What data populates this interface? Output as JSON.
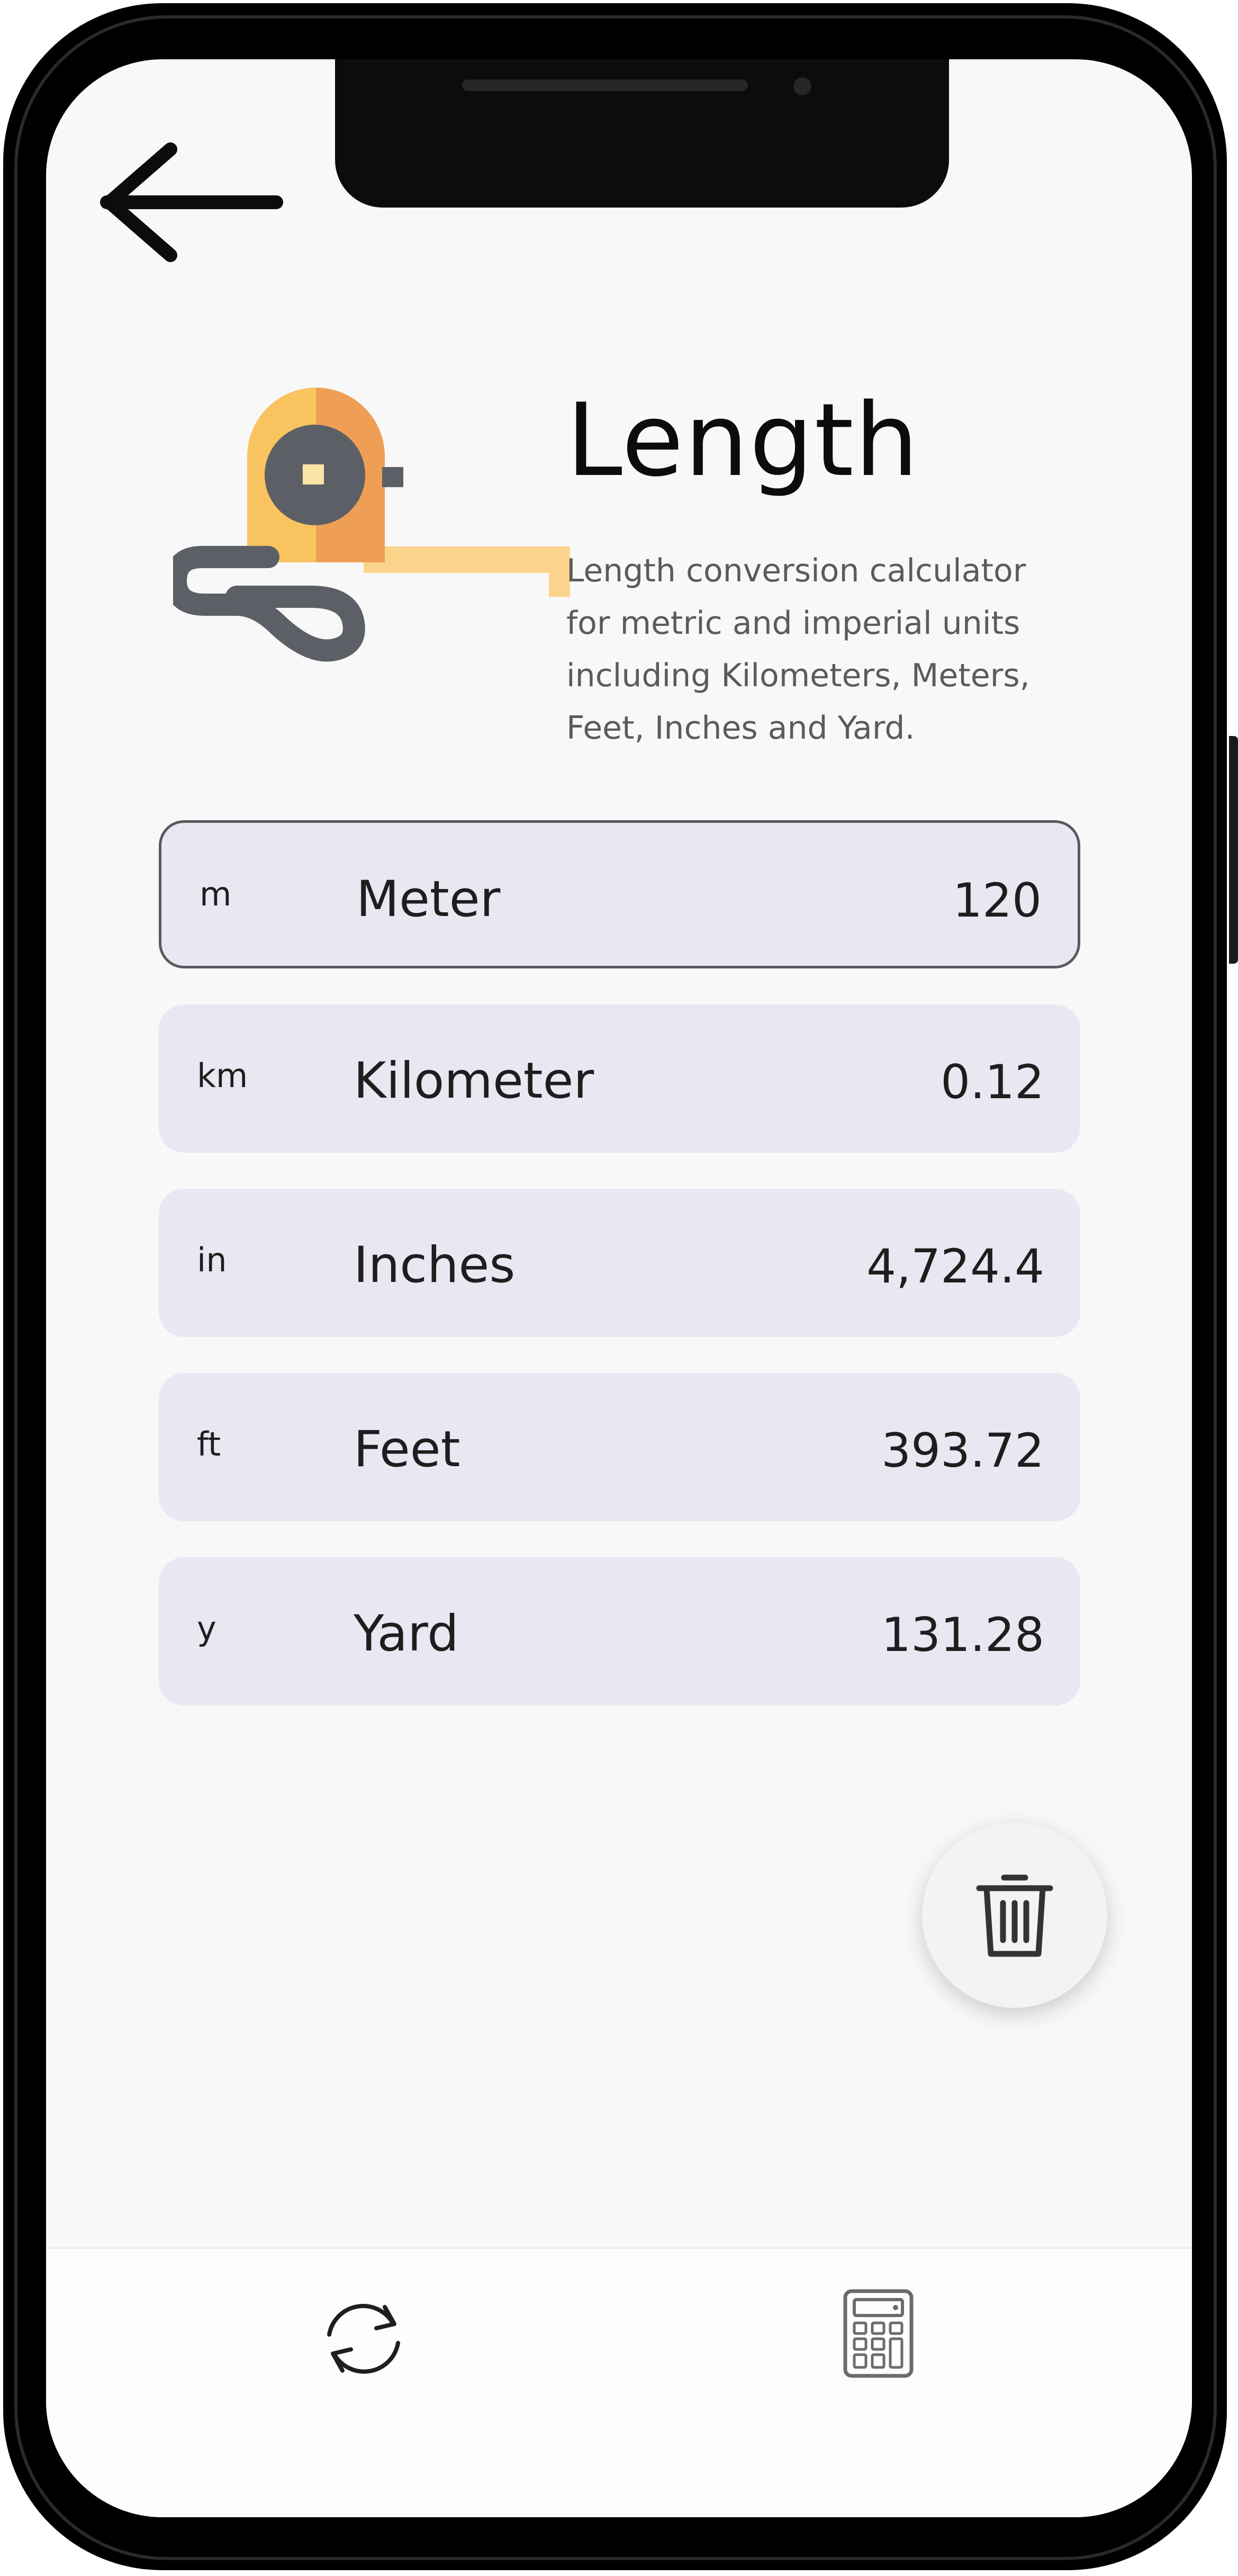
{
  "header": {
    "back_icon": "arrow-left-icon",
    "title": "Length",
    "description": "Length conversion calculator for metric and imperial units including Kilometers, Meters, Feet, Inches and Yard."
  },
  "hero": {
    "icon": "tape-measure-icon",
    "colors": {
      "body_light": "#f9c45f",
      "body_dark": "#ef9f55",
      "tape": "#fcd38a",
      "hub": "#5c6066",
      "center": "#fce4a6"
    }
  },
  "units": [
    {
      "abbr": "m",
      "name": "Meter",
      "value": "120",
      "selected": true
    },
    {
      "abbr": "km",
      "name": "Kilometer",
      "value": "0.12",
      "selected": false
    },
    {
      "abbr": "in",
      "name": "Inches",
      "value": "4,724.4",
      "selected": false
    },
    {
      "abbr": "ft",
      "name": "Feet",
      "value": "393.72",
      "selected": false
    },
    {
      "abbr": "y",
      "name": "Yard",
      "value": "131.28",
      "selected": false
    }
  ],
  "fab": {
    "icon": "trash-icon"
  },
  "bottom_nav": {
    "items": [
      {
        "icon": "refresh-icon"
      },
      {
        "icon": "calculator-icon"
      }
    ]
  },
  "colors": {
    "background": "#f8f8f8",
    "row_background": "#e7e8f1",
    "selected_border": "#5a5a5e",
    "text": "#1e1e1e",
    "muted_text": "#5b5b5b"
  }
}
